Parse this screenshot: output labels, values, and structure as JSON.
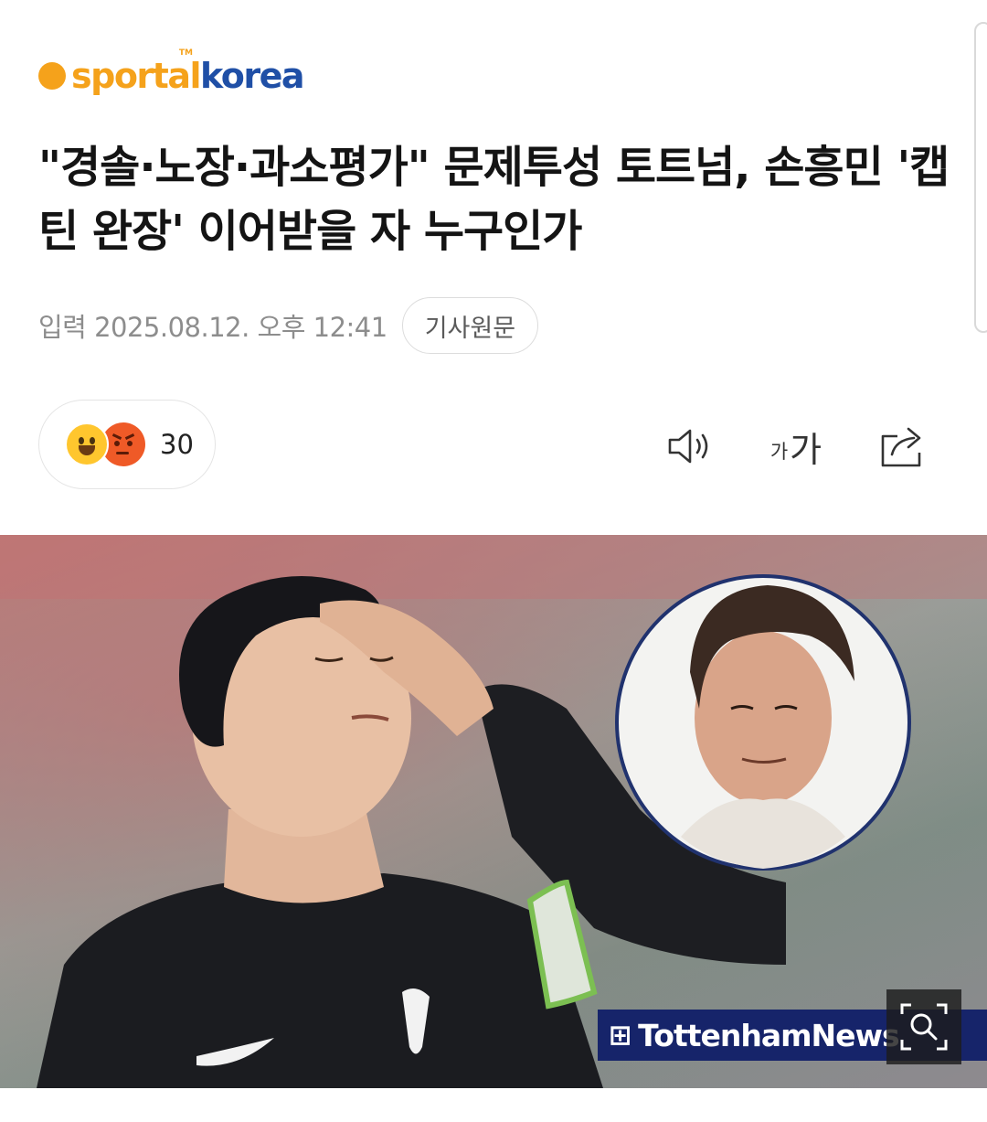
{
  "brand": {
    "logo_left": "sportal",
    "logo_tm": "TM",
    "logo_right": "korea",
    "accent_color": "#f5a21b",
    "brand_color": "#1f4fa6"
  },
  "article": {
    "headline": "\"경솔·노장·과소평가\" 문제투성 토트넘, 손흥민 '캡틴 완장' 이어받을 자 누구인가",
    "published": "입력 2025.08.12. 오후 12:41",
    "original_label": "기사원문"
  },
  "reactions": {
    "icons": [
      "happy-emoji-icon",
      "angry-emoji-icon"
    ],
    "count": "30"
  },
  "toolbar": {
    "speaker_icon": "speaker-icon",
    "font_small": "가",
    "font_big": "가",
    "share_icon": "share-icon"
  },
  "photo": {
    "watermark": "TottenhamNews",
    "zoom_icon": "zoom-icon"
  }
}
